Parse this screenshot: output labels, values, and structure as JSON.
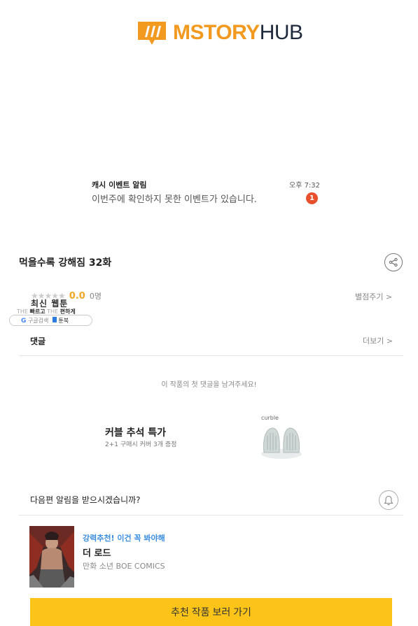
{
  "logo": {
    "text_brand": "MSTORY",
    "text_hub": "HUB"
  },
  "notice": {
    "title": "캐시 이벤트 알림",
    "time": "오후 7:32",
    "body": "이번주에 확인하지 못한 이벤트가 있습니다.",
    "badge": "1"
  },
  "episode": {
    "title": "먹을수록 강해짐 32화",
    "stars": "★★★★★",
    "score": "0.0",
    "count": "0명",
    "rate_link": "별점주기 >"
  },
  "widget": {
    "title": "최신 웹툰",
    "sub_the1": "THE",
    "sub_fast": "빠르고",
    "sub_the2": "THE",
    "sub_easy": "편하게",
    "google_g": "G",
    "google_text": "구글검색",
    "book_text": "툰북"
  },
  "comments": {
    "title": "댓글",
    "more": "더보기 >",
    "empty": "이 작품의 첫 댓글을 남겨주세요!"
  },
  "ad": {
    "title": "커블 추석 특가",
    "sub": "2+1 구매시 커버 3개 증정",
    "brand": "curble"
  },
  "next": {
    "question": "다음편 알림을 받으시겠습니까?"
  },
  "recommend": {
    "tag": "강력추천! 이건 꼭 봐야해",
    "title": "더 로드",
    "meta": "만화  소년  BOE COMICS",
    "cta": "추천 작품 보러 가기"
  },
  "colors": {
    "accent_orange": "#f29a1f",
    "cta_yellow": "#fcc419",
    "badge_red": "#e8502d",
    "link_blue": "#3b8de0"
  }
}
